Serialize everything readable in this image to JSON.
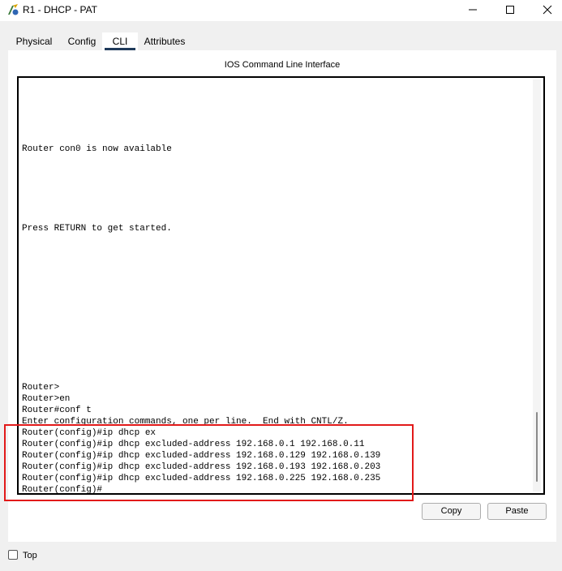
{
  "window": {
    "title": "R1 - DHCP - PAT"
  },
  "tabs": [
    {
      "label": "Physical",
      "active": false
    },
    {
      "label": "Config",
      "active": false
    },
    {
      "label": "CLI",
      "active": true
    },
    {
      "label": "Attributes",
      "active": false
    }
  ],
  "cli": {
    "panel_title": "IOS Command Line Interface",
    "lines": [
      "Router con0 is now available",
      "Press RETURN to get started.",
      "Router>",
      "Router>en",
      "Router#conf t",
      "Enter configuration commands, one per line.  End with CNTL/Z.",
      "Router(config)#ip dhcp ex",
      "Router(config)#ip dhcp excluded-address 192.168.0.1 192.168.0.11",
      "Router(config)#ip dhcp excluded-address 192.168.0.129 192.168.0.139",
      "Router(config)#ip dhcp excluded-address 192.168.0.193 192.168.0.203",
      "Router(config)#ip dhcp excluded-address 192.168.0.225 192.168.0.235",
      "Router(config)#"
    ]
  },
  "buttons": {
    "copy": "Copy",
    "paste": "Paste"
  },
  "top_checkbox": {
    "label": "Top",
    "checked": false
  },
  "colors": {
    "highlight_border": "#e21a1a",
    "tab_underline": "#1f3a5a"
  },
  "icons": {
    "app": "packet-tracer-router-icon",
    "minimize": "minimize-icon",
    "maximize": "maximize-icon",
    "close": "close-icon"
  }
}
